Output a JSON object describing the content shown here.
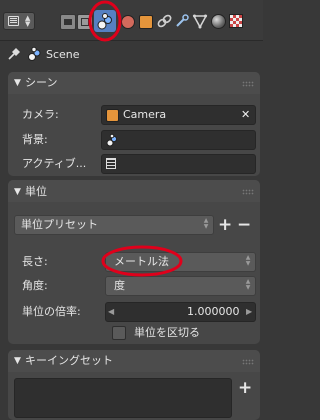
{
  "header": {
    "tab_icons": [
      "render-icon",
      "render-layers-icon",
      "scene-icon",
      "world-icon",
      "object-icon",
      "constraints-icon",
      "modifiers-icon",
      "data-icon",
      "material-icon",
      "texture-icon"
    ],
    "active_tab": "scene-icon"
  },
  "breadcrumb": {
    "label": "Scene"
  },
  "scene_panel": {
    "title": "シーン",
    "camera_label": "カメラ:",
    "camera_value": "Camera",
    "background_label": "背景:",
    "active_label": "アクティブ..."
  },
  "units_panel": {
    "title": "単位",
    "preset_label": "単位プリセット",
    "length_label": "長さ:",
    "length_value": "メートル法",
    "angle_label": "角度:",
    "angle_value": "度",
    "scale_label": "単位の倍率:",
    "scale_value": "1.000000",
    "separate_label": "単位を区切る"
  },
  "keying_panel": {
    "title": "キーイングセット"
  },
  "colors": {
    "background": "#383838",
    "panel": "#474747",
    "annotation": "#e0001b",
    "active_tab": "#5680c2"
  }
}
